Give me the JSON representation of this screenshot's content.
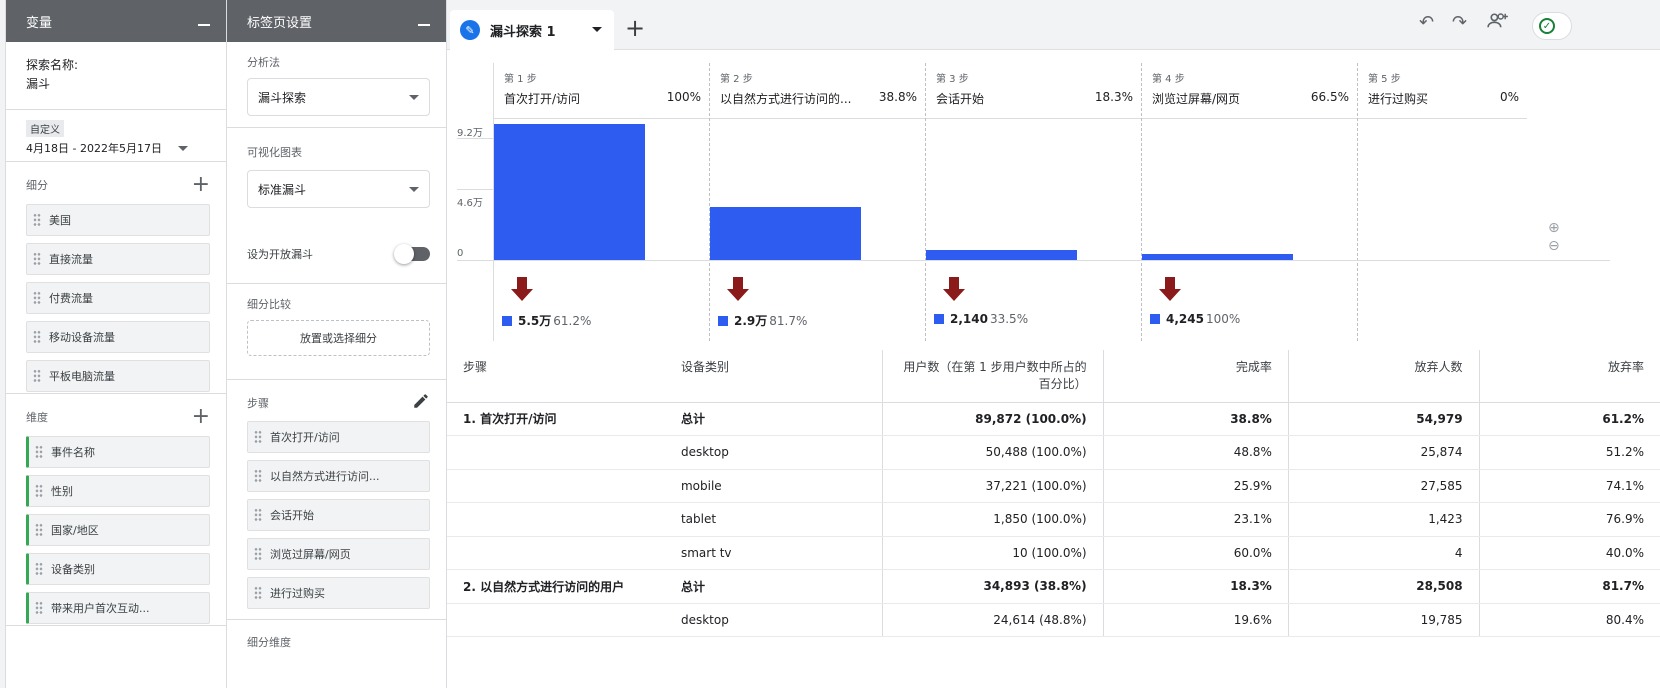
{
  "variables": {
    "header": "变量",
    "exploration_name_label": "探索名称:",
    "exploration_name": "漏斗",
    "date_badge": "自定义",
    "date_range": "4月18日 - 2022年5月17日",
    "segments_title": "细分",
    "segments": [
      "美国",
      "直接流量",
      "付费流量",
      "移动设备流量",
      "平板电脑流量"
    ],
    "dimensions_title": "维度",
    "dimensions": [
      "事件名称",
      "性别",
      "国家/地区",
      "设备类别",
      "带来用户首次互动..."
    ]
  },
  "tab_settings": {
    "header": "标签页设置",
    "technique_label": "分析法",
    "technique": "漏斗探索",
    "viz_label": "可视化图表",
    "viz": "标准漏斗",
    "open_funnel_label": "设为开放漏斗",
    "segment_compare_label": "细分比较",
    "segment_drop": "放置或选择细分",
    "steps_label": "步骤",
    "steps": [
      "首次打开/访问",
      "以自然方式进行访问...",
      "会话开始",
      "浏览过屏幕/网页",
      "进行过购买"
    ],
    "breakdown_label": "细分维度"
  },
  "tabbar": {
    "active_tab": "漏斗探索 1",
    "tab_icon": "pencil-icon"
  },
  "funnel": {
    "y_ticks": [
      "9.2万",
      "4.6万",
      "0"
    ],
    "steps": [
      {
        "num": "第 1 步",
        "name": "首次打开/访问",
        "pct": "100%",
        "drop_value": "5.5万",
        "drop_pct": "61.2%"
      },
      {
        "num": "第 2 步",
        "name": "以自然方式进行访问的...",
        "pct": "38.8%",
        "drop_value": "2.9万",
        "drop_pct": "81.7%"
      },
      {
        "num": "第 3 步",
        "name": "会话开始",
        "pct": "18.3%",
        "drop_value": "2,140",
        "drop_pct": "33.5%"
      },
      {
        "num": "第 4 步",
        "name": "浏览过屏幕/网页",
        "pct": "66.5%",
        "drop_value": "4,245",
        "drop_pct": "100%"
      },
      {
        "num": "第 5 步",
        "name": "进行过购买",
        "pct": "0%"
      }
    ]
  },
  "chart_data": {
    "type": "bar",
    "categories": [
      "首次打开/访问",
      "以自然方式进行访问的...",
      "会话开始",
      "浏览过屏幕/网页",
      "进行过购买"
    ],
    "values": [
      89872,
      34893,
      6385,
      4245,
      0
    ],
    "ylim": [
      0,
      92000
    ],
    "y_ticks": [
      "9.2万",
      "4.6万",
      "0"
    ],
    "bar_color": "#2e5bf0",
    "arrow_color": "#8b1a1a"
  },
  "table": {
    "headers": [
      "步骤",
      "设备类别",
      "用户数（在第 1 步用户数中所占的百分比）",
      "完成率",
      "放弃人数",
      "放弃率"
    ],
    "rows": [
      {
        "step": "1. 首次打开/访问",
        "device": "总计",
        "users": "89,872 (100.0%)",
        "completion": "38.8%",
        "abandon": "54,979",
        "abandon_rate": "61.2%",
        "total": true
      },
      {
        "step": "",
        "device": "desktop",
        "users": "50,488 (100.0%)",
        "completion": "48.8%",
        "abandon": "25,874",
        "abandon_rate": "51.2%"
      },
      {
        "step": "",
        "device": "mobile",
        "users": "37,221 (100.0%)",
        "completion": "25.9%",
        "abandon": "27,585",
        "abandon_rate": "74.1%"
      },
      {
        "step": "",
        "device": "tablet",
        "users": "1,850 (100.0%)",
        "completion": "23.1%",
        "abandon": "1,423",
        "abandon_rate": "76.9%"
      },
      {
        "step": "",
        "device": "smart tv",
        "users": "10 (100.0%)",
        "completion": "60.0%",
        "abandon": "4",
        "abandon_rate": "40.0%"
      },
      {
        "step": "2. 以自然方式进行访问的用户",
        "device": "总计",
        "users": "34,893 (38.8%)",
        "completion": "18.3%",
        "abandon": "28,508",
        "abandon_rate": "81.7%",
        "total": true
      },
      {
        "step": "",
        "device": "desktop",
        "users": "24,614 (48.8%)",
        "completion": "19.6%",
        "abandon": "19,785",
        "abandon_rate": "80.4%"
      }
    ]
  }
}
